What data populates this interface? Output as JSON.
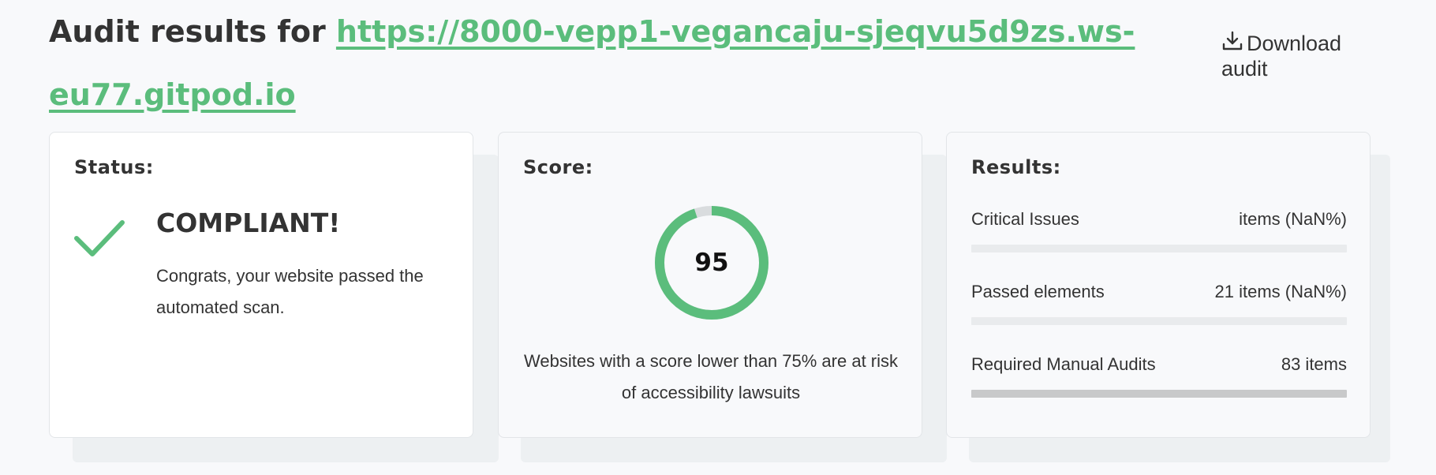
{
  "header": {
    "title_prefix": "Audit results for ",
    "url_line1": "https://8000-vepp1-vegancaju-sjeqvu5d9zs.ws-",
    "url_line2": "eu77.gitpod.io",
    "download_label": "Download audit"
  },
  "status_card": {
    "title": "Status:",
    "heading": "COMPLIANT!",
    "message": "Congrats, your website passed the automated scan."
  },
  "score_card": {
    "title": "Score:",
    "score": "95",
    "score_fraction": 0.95,
    "note": "Websites with a score lower than 75% are at risk of accessibility lawsuits"
  },
  "results_card": {
    "title": "Results:",
    "rows": [
      {
        "label": "Critical Issues",
        "value": "items (NaN%)",
        "fill": 0
      },
      {
        "label": "Passed elements",
        "value": "21 items (NaN%)",
        "fill": 0
      },
      {
        "label": "Required Manual Audits",
        "value": "83 items",
        "fill": 1
      }
    ]
  },
  "colors": {
    "accent": "#5bbd7c",
    "gauge_track": "#d9dcde",
    "text": "#333333"
  },
  "icons": {
    "download": "download-icon",
    "status": "checkmark-icon"
  }
}
